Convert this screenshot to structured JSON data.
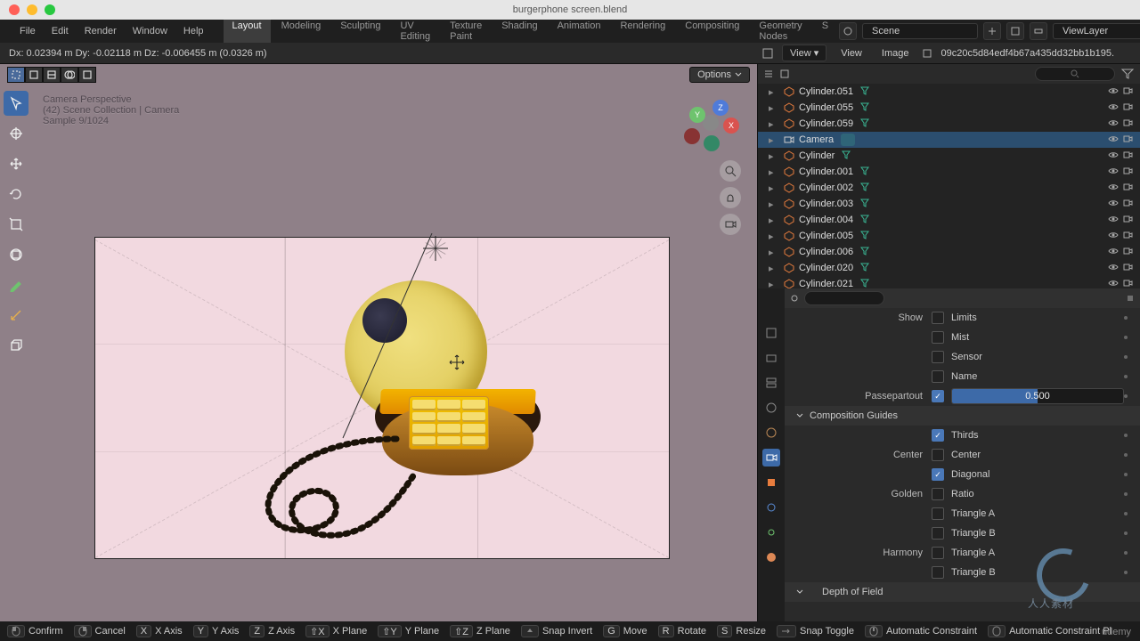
{
  "window": {
    "title": "burgerphone screen.blend"
  },
  "menu": {
    "file": "File",
    "edit": "Edit",
    "render": "Render",
    "window": "Window",
    "help": "Help"
  },
  "workspaces": {
    "items": [
      "Layout",
      "Modeling",
      "Sculpting",
      "UV Editing",
      "Texture Paint",
      "Shading",
      "Animation",
      "Rendering",
      "Compositing",
      "Geometry Nodes",
      "S"
    ],
    "active": "Layout"
  },
  "scene_field": "Scene",
  "viewlayer_field": "ViewLayer",
  "image_header": {
    "view": "View",
    "view_menu": "View",
    "image": "Image",
    "dropdown": "View ▾",
    "image_slot": "09c20c5d84edf4b67a435dd32bb1b195."
  },
  "transform": {
    "text": "Dx: 0.02394 m   Dy: -0.02118 m   Dz: -0.006455 m (0.0326 m)"
  },
  "options_label": "Options",
  "overlay": {
    "line1": "Camera Perspective",
    "line2": "(42) Scene Collection | Camera",
    "line3": "Sample 9/1024"
  },
  "gizmo": {
    "x": "X",
    "y": "Y",
    "z": "Z"
  },
  "outliner": {
    "items": [
      {
        "name": "Cylinder.051",
        "type": "mesh"
      },
      {
        "name": "Cylinder.055",
        "type": "mesh"
      },
      {
        "name": "Cylinder.059",
        "type": "mesh"
      },
      {
        "name": "Camera",
        "type": "camera",
        "selected": true
      },
      {
        "name": "Cylinder",
        "type": "mesh"
      },
      {
        "name": "Cylinder.001",
        "type": "mesh"
      },
      {
        "name": "Cylinder.002",
        "type": "mesh"
      },
      {
        "name": "Cylinder.003",
        "type": "mesh"
      },
      {
        "name": "Cylinder.004",
        "type": "mesh"
      },
      {
        "name": "Cylinder.005",
        "type": "mesh"
      },
      {
        "name": "Cylinder.006",
        "type": "mesh"
      },
      {
        "name": "Cylinder.020",
        "type": "mesh"
      },
      {
        "name": "Cylinder.021",
        "type": "mesh"
      }
    ]
  },
  "props": {
    "show_label": "Show",
    "show_limits": "Limits",
    "show_mist": "Mist",
    "show_sensor": "Sensor",
    "show_name": "Name",
    "passepartout": "Passepartout",
    "passepartout_val": "0.500",
    "comp_guides": "Composition Guides",
    "thirds": "Thirds",
    "center_lbl": "Center",
    "center": "Center",
    "diagonal": "Diagonal",
    "golden_lbl": "Golden",
    "ratio": "Ratio",
    "triA": "Triangle A",
    "triB": "Triangle B",
    "harmony_lbl": "Harmony",
    "harmA": "Triangle A",
    "harmB": "Triangle B",
    "dof": "Depth of Field"
  },
  "statusbar": {
    "confirm": "Confirm",
    "cancel": "Cancel",
    "x": "X Axis",
    "y": "Y Axis",
    "z": "Z Axis",
    "xp": "X Plane",
    "yp": "Y Plane",
    "zp": "Z Plane",
    "snapinv": "Snap Invert",
    "move": "Move",
    "rotate": "Rotate",
    "resize": "Resize",
    "snaptog": "Snap Toggle",
    "autoconst": "Automatic Constraint",
    "autoconstp": "Automatic Constraint Pl",
    "keys": {
      "x": "X",
      "y": "Y",
      "z": "Z",
      "sx": "⇧X",
      "sy": "⇧Y",
      "sz": "⇧Z",
      "g": "G",
      "r": "R",
      "s": "S"
    }
  },
  "watermark": {
    "txt": "人人素材"
  },
  "udemy": "ûdemy"
}
